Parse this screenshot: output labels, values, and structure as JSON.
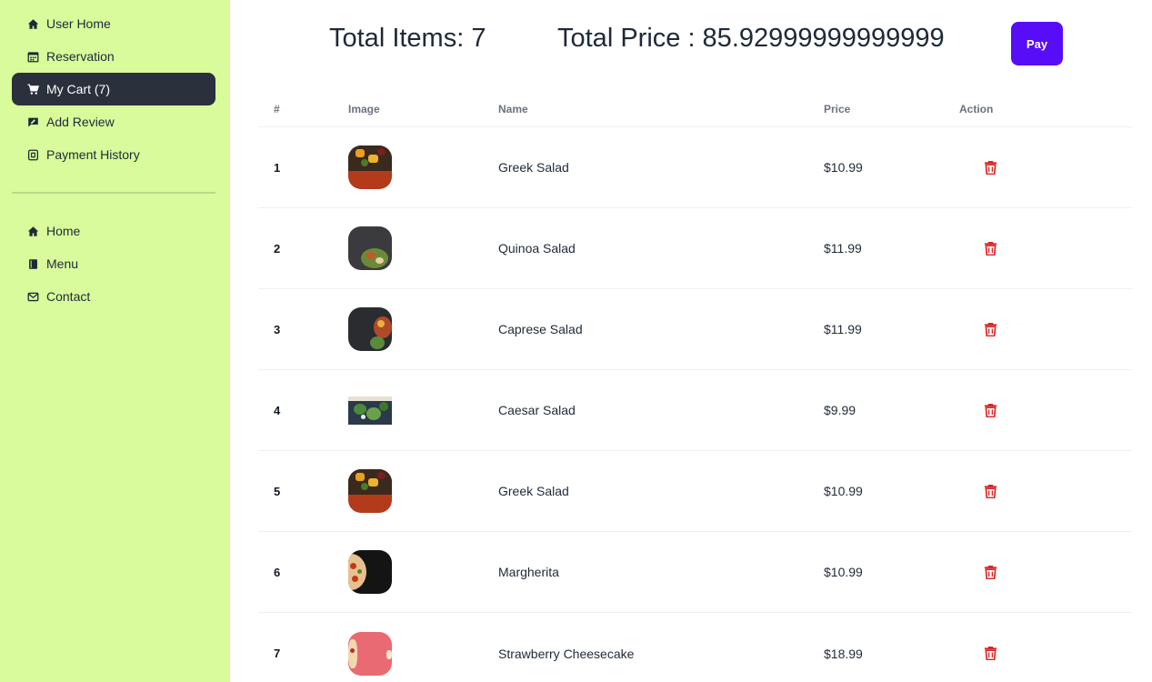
{
  "sidebar": {
    "top_items": [
      {
        "label": "User Home",
        "icon": "home-icon",
        "active": false
      },
      {
        "label": "Reservation",
        "icon": "calendar-icon",
        "active": false
      },
      {
        "label": "My Cart (7)",
        "icon": "cart-icon",
        "active": true
      },
      {
        "label": "Add Review",
        "icon": "review-icon",
        "active": false
      },
      {
        "label": "Payment History",
        "icon": "payment-icon",
        "active": false
      }
    ],
    "bottom_items": [
      {
        "label": "Home",
        "icon": "home-icon"
      },
      {
        "label": "Menu",
        "icon": "book-icon"
      },
      {
        "label": "Contact",
        "icon": "envelope-icon"
      }
    ]
  },
  "summary": {
    "total_items": "Total Items: 7",
    "total_price": "Total Price : 85.92999999999999",
    "pay_label": "Pay"
  },
  "table": {
    "headers": {
      "num": "#",
      "image": "Image",
      "name": "Name",
      "price": "Price",
      "action": "Action"
    },
    "rows": [
      {
        "num": "1",
        "name": "Greek Salad",
        "price": "$10.99"
      },
      {
        "num": "2",
        "name": "Quinoa Salad",
        "price": "$11.99"
      },
      {
        "num": "3",
        "name": "Caprese Salad",
        "price": "$11.99"
      },
      {
        "num": "4",
        "name": "Caesar Salad",
        "price": "$9.99"
      },
      {
        "num": "5",
        "name": "Greek Salad",
        "price": "$10.99"
      },
      {
        "num": "6",
        "name": "Margherita",
        "price": "$10.99"
      },
      {
        "num": "7",
        "name": "Strawberry Cheesecake",
        "price": "$18.99"
      }
    ]
  },
  "colors": {
    "sidebar_bg": "#d9fb9b",
    "active_nav_bg": "#2a303c",
    "pay_button": "#570df8",
    "delete_icon": "#dc2626"
  }
}
